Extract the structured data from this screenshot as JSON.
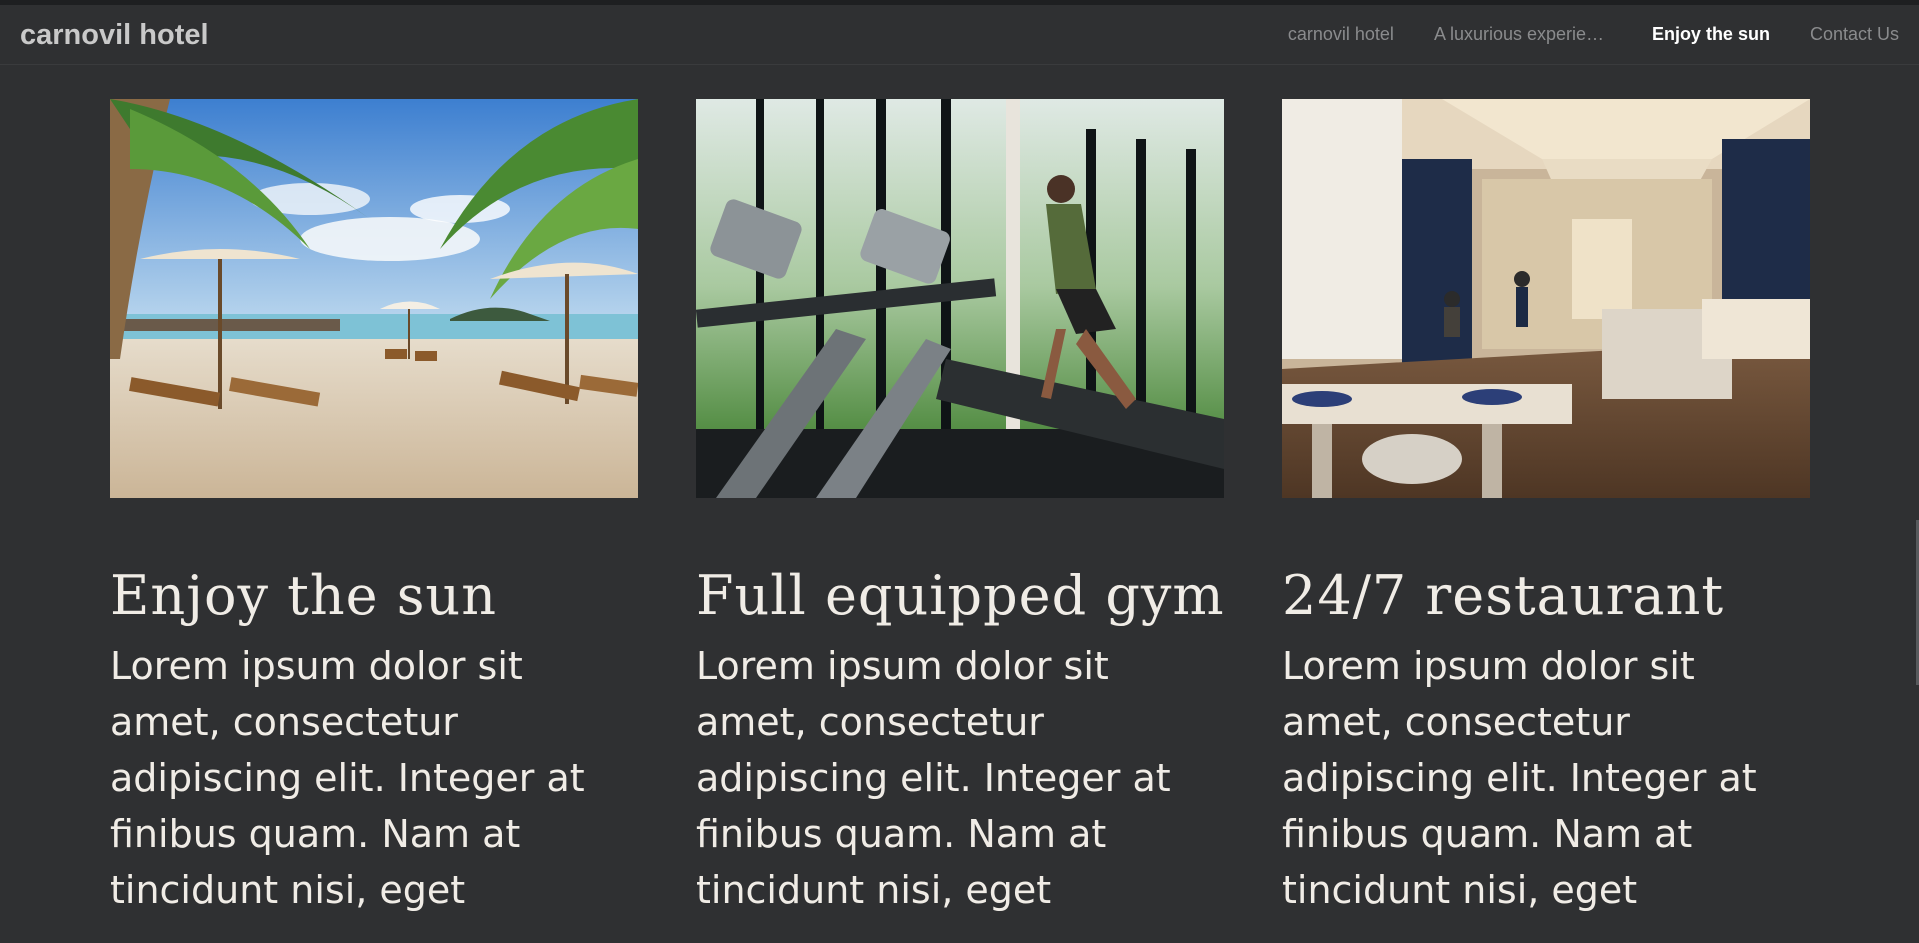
{
  "navbar": {
    "brand": "carnovil hotel",
    "links": [
      {
        "label": "carnovil hotel",
        "active": false
      },
      {
        "label": "A luxurious experience",
        "active": false
      },
      {
        "label": "Enjoy the sun",
        "active": true
      },
      {
        "label": "Contact Us",
        "active": false
      }
    ]
  },
  "cards": [
    {
      "title": "Enjoy the sun",
      "text": "Lorem ipsum dolor sit amet, consectetur adipiscing elit. Integer at finibus quam. Nam at tincidunt nisi, eget",
      "image": "beach-photo"
    },
    {
      "title": "Full equipped gym",
      "text": "Lorem ipsum dolor sit amet, consectetur adipiscing elit. Integer at finibus quam. Nam at tincidunt nisi, eget",
      "image": "gym-photo"
    },
    {
      "title": "24/7 restaurant",
      "text": "Lorem ipsum dolor sit amet, consectetur adipiscing elit. Integer at finibus quam. Nam at tincidunt nisi, eget",
      "image": "restaurant-photo"
    }
  ],
  "colors": {
    "background": "#2f3032",
    "text": "#f0ece6",
    "nav_inactive": "#8a8b8d",
    "nav_active": "#ffffff"
  }
}
